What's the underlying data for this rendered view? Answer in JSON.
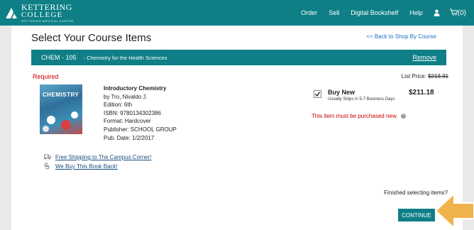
{
  "header": {
    "logo": {
      "line1": "KETTERING",
      "line2": "COLLEGE",
      "line3": "KETTERING MEDICAL CENTER"
    },
    "nav": [
      {
        "label": "Order"
      },
      {
        "label": "Sell"
      },
      {
        "label": "Digital Bookshelf"
      },
      {
        "label": "Help"
      }
    ],
    "user_icon": "user-icon",
    "cart": {
      "icon": "cart-icon",
      "count": "(0)"
    }
  },
  "page": {
    "title": "Select Your Course Items",
    "back_link": "<< Back to Shop By Course"
  },
  "course": {
    "code": "CHEM - 105",
    "name": "- Chemistry for the Health Sciences",
    "remove": "Remove"
  },
  "item": {
    "requirement": "Required",
    "list_price_label": "List Price:",
    "list_price": "$213.31",
    "cover_title": "CHEMISTRY",
    "title": "Introductory Chemistry",
    "author": "by Tro, Nivaldo J.",
    "edition": "Edition: 6th",
    "isbn": "ISBN: 9780134302386",
    "format": "Format: Hardcover",
    "publisher": "Publisher: SCHOOL GROUP",
    "pub_date": "Pub. Date: 1/2/2017",
    "perks": [
      {
        "icon": "truck-icon",
        "label": "Free Shipping to The Campus Corner!"
      },
      {
        "icon": "buyback-icon",
        "label": "We Buy This Book Back!"
      }
    ],
    "option": {
      "checked": true,
      "label": "Buy New",
      "shipping": "Usually Ships in 5-7 Business Days",
      "price": "$211.18"
    },
    "notice": "This item must be purchased new."
  },
  "footer": {
    "finished_text": "Finished selecting items?",
    "continue_label": "CONTINUE"
  },
  "colors": {
    "brand": "#0e7f86",
    "required": "#cc0000",
    "link": "#1a6fc4",
    "arrow": "#f0b24a"
  }
}
